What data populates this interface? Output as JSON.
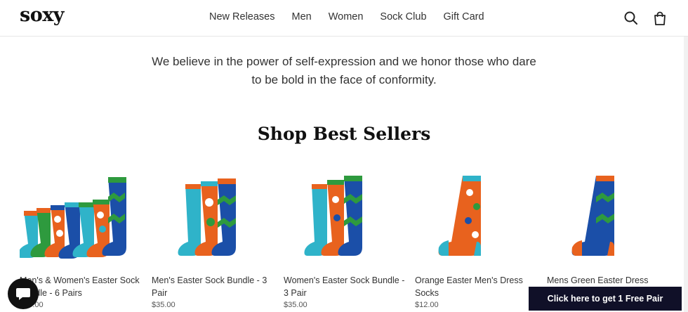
{
  "brand": {
    "logo": "soxy"
  },
  "nav": {
    "items": [
      "New Releases",
      "Men",
      "Women",
      "Sock Club",
      "Gift Card"
    ]
  },
  "header_icons": [
    "search-icon",
    "cart-icon"
  ],
  "hero": {
    "tagline_line1": "We believe in the power of self-expression and we honor those who dare",
    "tagline_line2": "to be bold in the face of conformity."
  },
  "section": {
    "title": "Shop Best Sellers"
  },
  "products": [
    {
      "name": "Men's & Women's Easter Sock Bundle - 6 Pairs",
      "price": "$65.00"
    },
    {
      "name": "Men's Easter Sock Bundle - 3 Pair",
      "price": "$35.00"
    },
    {
      "name": "Women's Easter Sock Bundle - 3 Pair",
      "price": "$35.00"
    },
    {
      "name": "Orange Easter Men's Dress Socks",
      "price": "$12.00"
    },
    {
      "name": "Mens Green Easter Dress",
      "price": ""
    }
  ],
  "promo": {
    "label": "Click here to get 1 Free Pair"
  },
  "colors": {
    "sock_blue": "#1b4fa8",
    "sock_orange": "#e8621e",
    "sock_teal": "#2fb3c9",
    "sock_green": "#2e9a3e",
    "promo_bg": "#101028"
  }
}
